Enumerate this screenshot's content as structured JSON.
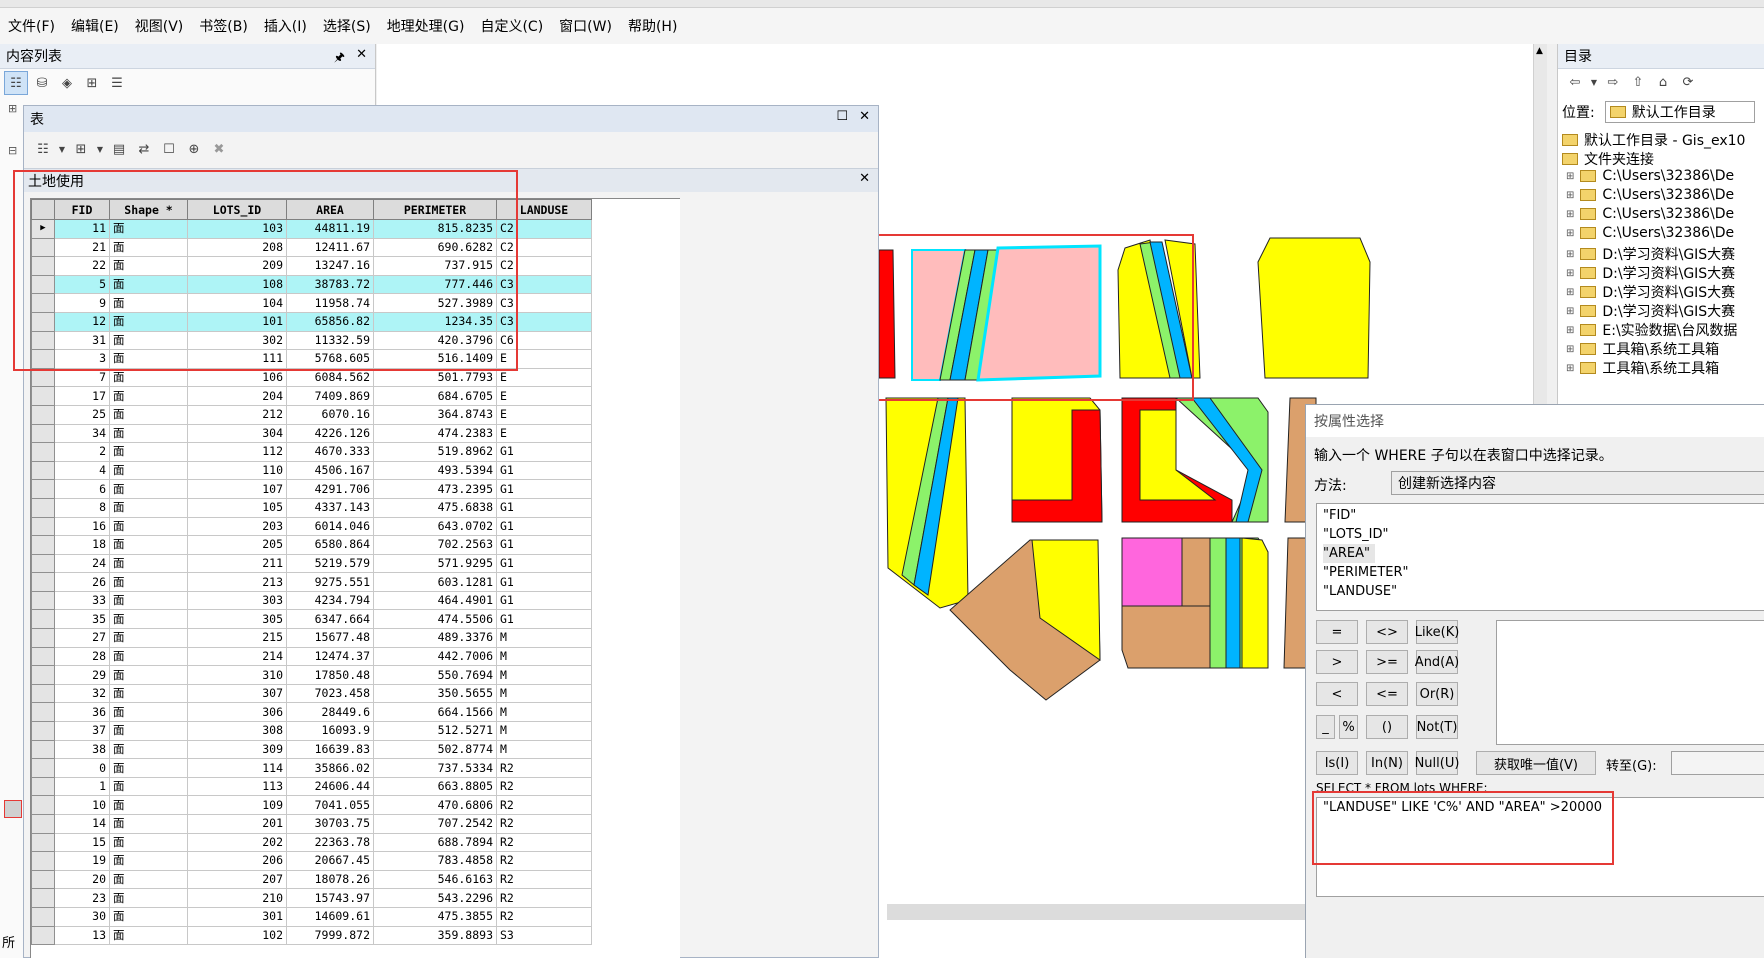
{
  "menu": [
    "文件(F)",
    "编辑(E)",
    "视图(V)",
    "书签(B)",
    "插入(I)",
    "选择(S)",
    "地理处理(G)",
    "自定义(C)",
    "窗口(W)",
    "帮助(H)"
  ],
  "toc": {
    "title": "内容列表",
    "pin": "🖈",
    "close": "✕",
    "status_fragment": "所"
  },
  "table_window": {
    "title": "表",
    "layer_name": "土地使用",
    "columns": [
      "FID",
      "Shape *",
      "LOTS_ID",
      "AREA",
      "PERIMETER",
      "LANDUSE"
    ],
    "rows": [
      {
        "fid": "11",
        "shape": "面",
        "lots": "103",
        "area": "44811.19",
        "perim": "815.8235",
        "landuse": "C2",
        "hl": true
      },
      {
        "fid": "21",
        "shape": "面",
        "lots": "208",
        "area": "12411.67",
        "perim": "690.6282",
        "landuse": "C2",
        "hl": false
      },
      {
        "fid": "22",
        "shape": "面",
        "lots": "209",
        "area": "13247.16",
        "perim": "737.915",
        "landuse": "C2",
        "hl": false
      },
      {
        "fid": "5",
        "shape": "面",
        "lots": "108",
        "area": "38783.72",
        "perim": "777.446",
        "landuse": "C3",
        "hl": true
      },
      {
        "fid": "9",
        "shape": "面",
        "lots": "104",
        "area": "11958.74",
        "perim": "527.3989",
        "landuse": "C3",
        "hl": false
      },
      {
        "fid": "12",
        "shape": "面",
        "lots": "101",
        "area": "65856.82",
        "perim": "1234.35",
        "landuse": "C3",
        "hl": true
      },
      {
        "fid": "31",
        "shape": "面",
        "lots": "302",
        "area": "11332.59",
        "perim": "420.3796",
        "landuse": "C6",
        "hl": false
      },
      {
        "fid": "3",
        "shape": "面",
        "lots": "111",
        "area": "5768.605",
        "perim": "516.1409",
        "landuse": "E",
        "hl": false
      },
      {
        "fid": "7",
        "shape": "面",
        "lots": "106",
        "area": "6084.562",
        "perim": "501.7793",
        "landuse": "E",
        "hl": false
      },
      {
        "fid": "17",
        "shape": "面",
        "lots": "204",
        "area": "7409.869",
        "perim": "684.6705",
        "landuse": "E",
        "hl": false
      },
      {
        "fid": "25",
        "shape": "面",
        "lots": "212",
        "area": "6070.16",
        "perim": "364.8743",
        "landuse": "E",
        "hl": false
      },
      {
        "fid": "34",
        "shape": "面",
        "lots": "304",
        "area": "4226.126",
        "perim": "474.2383",
        "landuse": "E",
        "hl": false
      },
      {
        "fid": "2",
        "shape": "面",
        "lots": "112",
        "area": "4670.333",
        "perim": "519.8962",
        "landuse": "G1",
        "hl": false
      },
      {
        "fid": "4",
        "shape": "面",
        "lots": "110",
        "area": "4506.167",
        "perim": "493.5394",
        "landuse": "G1",
        "hl": false
      },
      {
        "fid": "6",
        "shape": "面",
        "lots": "107",
        "area": "4291.706",
        "perim": "473.2395",
        "landuse": "G1",
        "hl": false
      },
      {
        "fid": "8",
        "shape": "面",
        "lots": "105",
        "area": "4337.143",
        "perim": "475.6838",
        "landuse": "G1",
        "hl": false
      },
      {
        "fid": "16",
        "shape": "面",
        "lots": "203",
        "area": "6014.046",
        "perim": "643.0702",
        "landuse": "G1",
        "hl": false
      },
      {
        "fid": "18",
        "shape": "面",
        "lots": "205",
        "area": "6580.864",
        "perim": "702.2563",
        "landuse": "G1",
        "hl": false
      },
      {
        "fid": "24",
        "shape": "面",
        "lots": "211",
        "area": "5219.579",
        "perim": "571.9295",
        "landuse": "G1",
        "hl": false
      },
      {
        "fid": "26",
        "shape": "面",
        "lots": "213",
        "area": "9275.551",
        "perim": "603.1281",
        "landuse": "G1",
        "hl": false
      },
      {
        "fid": "33",
        "shape": "面",
        "lots": "303",
        "area": "4234.794",
        "perim": "464.4901",
        "landuse": "G1",
        "hl": false
      },
      {
        "fid": "35",
        "shape": "面",
        "lots": "305",
        "area": "6347.664",
        "perim": "474.5506",
        "landuse": "G1",
        "hl": false
      },
      {
        "fid": "27",
        "shape": "面",
        "lots": "215",
        "area": "15677.48",
        "perim": "489.3376",
        "landuse": "M",
        "hl": false
      },
      {
        "fid": "28",
        "shape": "面",
        "lots": "214",
        "area": "12474.37",
        "perim": "442.7006",
        "landuse": "M",
        "hl": false
      },
      {
        "fid": "29",
        "shape": "面",
        "lots": "310",
        "area": "17850.48",
        "perim": "550.7694",
        "landuse": "M",
        "hl": false
      },
      {
        "fid": "32",
        "shape": "面",
        "lots": "307",
        "area": "7023.458",
        "perim": "350.5655",
        "landuse": "M",
        "hl": false
      },
      {
        "fid": "36",
        "shape": "面",
        "lots": "306",
        "area": "28449.6",
        "perim": "664.1566",
        "landuse": "M",
        "hl": false
      },
      {
        "fid": "37",
        "shape": "面",
        "lots": "308",
        "area": "16093.9",
        "perim": "512.5271",
        "landuse": "M",
        "hl": false
      },
      {
        "fid": "38",
        "shape": "面",
        "lots": "309",
        "area": "16639.83",
        "perim": "502.8774",
        "landuse": "M",
        "hl": false
      },
      {
        "fid": "0",
        "shape": "面",
        "lots": "114",
        "area": "35866.02",
        "perim": "737.5334",
        "landuse": "R2",
        "hl": false
      },
      {
        "fid": "1",
        "shape": "面",
        "lots": "113",
        "area": "24606.44",
        "perim": "663.8805",
        "landuse": "R2",
        "hl": false
      },
      {
        "fid": "10",
        "shape": "面",
        "lots": "109",
        "area": "7041.055",
        "perim": "470.6806",
        "landuse": "R2",
        "hl": false
      },
      {
        "fid": "14",
        "shape": "面",
        "lots": "201",
        "area": "30703.75",
        "perim": "707.2542",
        "landuse": "R2",
        "hl": false
      },
      {
        "fid": "15",
        "shape": "面",
        "lots": "202",
        "area": "22363.78",
        "perim": "688.7894",
        "landuse": "R2",
        "hl": false
      },
      {
        "fid": "19",
        "shape": "面",
        "lots": "206",
        "area": "20667.45",
        "perim": "783.4858",
        "landuse": "R2",
        "hl": false
      },
      {
        "fid": "20",
        "shape": "面",
        "lots": "207",
        "area": "18078.26",
        "perim": "546.6163",
        "landuse": "R2",
        "hl": false
      },
      {
        "fid": "23",
        "shape": "面",
        "lots": "210",
        "area": "15743.97",
        "perim": "543.2296",
        "landuse": "R2",
        "hl": false
      },
      {
        "fid": "30",
        "shape": "面",
        "lots": "301",
        "area": "14609.61",
        "perim": "475.3855",
        "landuse": "R2",
        "hl": false
      },
      {
        "fid": "13",
        "shape": "面",
        "lots": "102",
        "area": "7999.872",
        "perim": "359.8893",
        "landuse": "S3",
        "hl": false
      }
    ]
  },
  "catalog": {
    "title": "目录",
    "location_label": "位置:",
    "location_value": "默认工作目录",
    "items": [
      "默认工作目录 - Gis_ex10",
      "文件夹连接",
      "C:\\Users\\32386\\De",
      "C:\\Users\\32386\\De",
      "C:\\Users\\32386\\De",
      "C:\\Users\\32386\\De",
      "D:\\学习资料\\GIS大赛",
      "D:\\学习资料\\GIS大赛",
      "D:\\学习资料\\GIS大赛",
      "D:\\学习资料\\GIS大赛",
      "E:\\实验数据\\台风数据",
      "工具箱\\系统工具箱",
      "工具箱\\系统工具箱"
    ]
  },
  "dialog": {
    "title": "按属性选择",
    "prompt": "输入一个 WHERE 子句以在表窗口中选择记录。",
    "method_label": "方法:",
    "method_value": "创建新选择内容",
    "fields": [
      "\"FID\"",
      "\"LOTS_ID\"",
      "\"AREA\"",
      "\"PERIMETER\"",
      "\"LANDUSE\""
    ],
    "operators": [
      "=",
      "<>",
      "Like(K)",
      ">",
      ">=",
      "And(A)",
      "<",
      "<=",
      "Or(R)",
      "_",
      "%",
      "()",
      "Not(T)",
      "Is(I)",
      "In(N)",
      "Null(U)"
    ],
    "unique_button": "获取唯一值(V)",
    "goto_label": "转至(G):",
    "sql_header": "SELECT * FROM lots WHERE:",
    "sql_expression": "\"LANDUSE\" LIKE 'C%' AND \"AREA\" >20000"
  },
  "colors": {
    "highlight_row": "#aef4f6",
    "annotation_red": "#e53935",
    "map_cyan": "#00e5ff"
  }
}
